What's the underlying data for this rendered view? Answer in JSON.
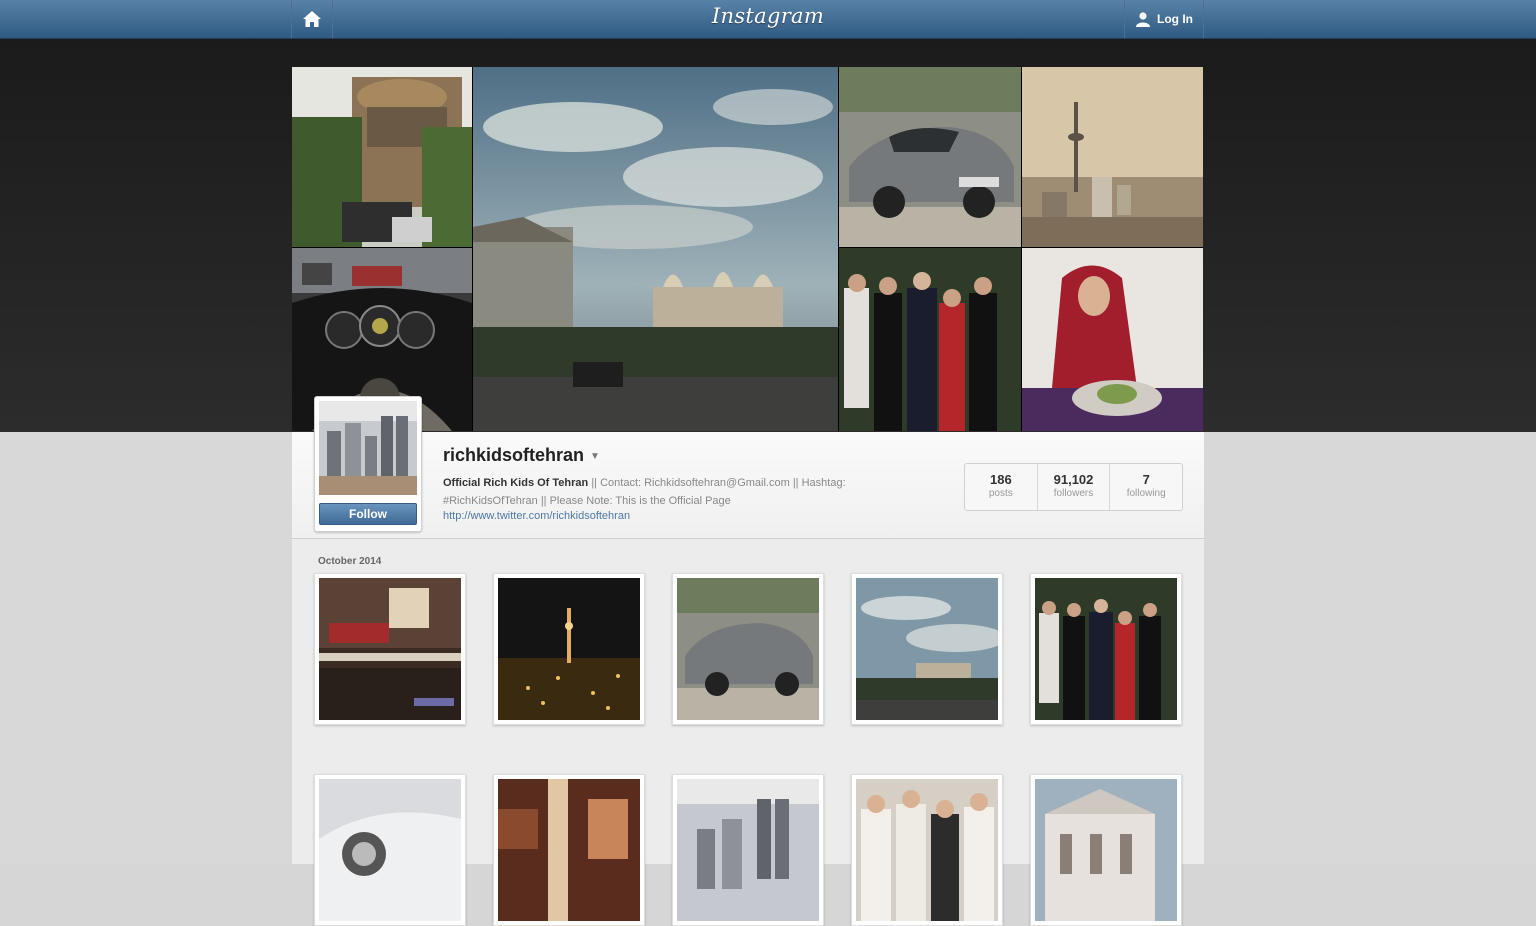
{
  "header": {
    "home_icon": "home-icon",
    "logo": "Instagram",
    "login_icon": "user-icon",
    "login_label": "Log In"
  },
  "profile": {
    "username": "richkidsoftehran",
    "bio_name": "Official Rich Kids Of Tehran",
    "bio_rest_line1": " || Contact: Richkidsoftehran@Gmail.com || Hashtag:",
    "bio_line2": "#RichKidsOfTehran || Please Note: This is the Official Page",
    "link": "http://www.twitter.com/richkidsoftehran",
    "follow_label": "Follow",
    "stats": [
      {
        "num": "186",
        "label": "posts"
      },
      {
        "num": "91,102",
        "label": "followers"
      },
      {
        "num": "7",
        "label": "following"
      }
    ]
  },
  "feed": {
    "month": "October 2014",
    "row1": [
      "hotel-lobby",
      "city-night-tower",
      "silver-sports-car",
      "palace-sky",
      "party-group"
    ],
    "row2": [
      "white-car",
      "restaurant-interior",
      "skyline-poster",
      "bridal-party",
      "white-mansion"
    ]
  },
  "hero_tiles": [
    "villa-house",
    "palace-clouds",
    "silver-sports-car",
    "tehran-tower",
    "car-dashboard",
    "party-group",
    "woman-dinner"
  ],
  "colors": {
    "topbar": "#3e6b96",
    "accent": "#4c79a5",
    "dark_bg": "#222222"
  }
}
